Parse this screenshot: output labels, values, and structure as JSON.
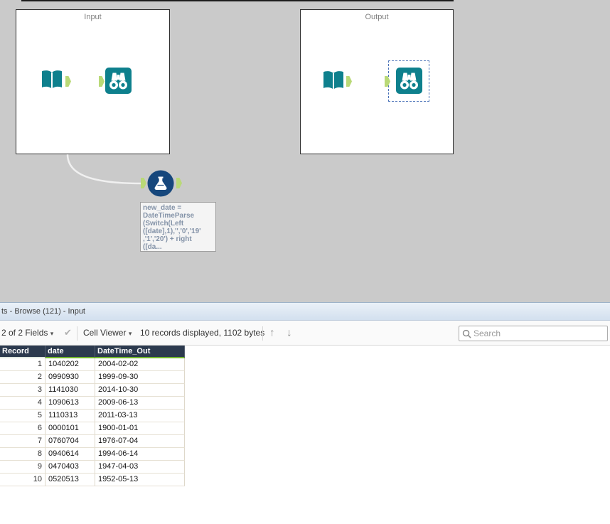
{
  "canvas": {
    "input_container_label": "Input",
    "output_container_label": "Output",
    "annotation_text": "new_date =\nDateTimeParse\n(Switch(Left\n([date],1),'','0','19'\n,'1','20') + right\n([da..."
  },
  "results": {
    "panel_title": "ts - Browse (121) - Input",
    "toolbar": {
      "fields_label": "2 of 2 Fields",
      "cell_viewer_label": "Cell Viewer",
      "records_info": "10 records displayed, 1102 bytes",
      "search_placeholder": "Search"
    },
    "table": {
      "columns": [
        "Record",
        "date",
        "DateTime_Out"
      ],
      "rows": [
        [
          "1",
          "1040202",
          "2004-02-02"
        ],
        [
          "2",
          "0990930",
          "1999-09-30"
        ],
        [
          "3",
          "1141030",
          "2014-10-30"
        ],
        [
          "4",
          "1090613",
          "2009-06-13"
        ],
        [
          "5",
          "1110313",
          "2011-03-13"
        ],
        [
          "6",
          "0000101",
          "1900-01-01"
        ],
        [
          "7",
          "0760704",
          "1976-07-04"
        ],
        [
          "8",
          "0940614",
          "1994-06-14"
        ],
        [
          "9",
          "0470403",
          "1947-04-03"
        ],
        [
          "10",
          "0520513",
          "1952-05-13"
        ]
      ]
    }
  },
  "colors": {
    "tool_teal": "#0e808d",
    "formula_navy": "#16477c",
    "anchor_green": "#b9d977",
    "connection_blue": "#3c43c4",
    "grid_header_navy": "#2c3a4e",
    "grid_header_underline_green": "#72b62c",
    "canvas_gray": "#cacaca"
  }
}
